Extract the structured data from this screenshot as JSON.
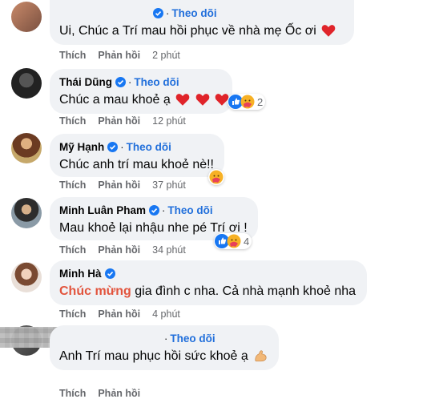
{
  "comments": [
    {
      "name": "",
      "follow": "Theo dõi",
      "text": "Ui, Chúc a Trí mau hồi phục về nhà mẹ Ốc ơi",
      "like": "Thích",
      "reply": "Phản hồi",
      "time": "2 phút",
      "trailing_emoji": "red-heart"
    },
    {
      "name": "Thái Dũng",
      "follow": "Theo dõi",
      "text": "Chúc a mau khoẻ ạ",
      "like": "Thích",
      "reply": "Phản hồi",
      "time": "12 phút",
      "trailing_emoji": "red-heart x3",
      "reaction_count": "2"
    },
    {
      "name": "Mỹ Hạnh",
      "follow": "Theo dõi",
      "text": "Chúc anh trí mau khoẻ nè!!",
      "like": "Thích",
      "reply": "Phản hồi",
      "time": "37 phút"
    },
    {
      "name": "Minh Luân Pham",
      "follow": "Theo dõi",
      "text": "Mau khoẻ lại nhậu nhe pé Trí ơi !",
      "like": "Thích",
      "reply": "Phản hồi",
      "time": "34 phút",
      "reaction_count": "4"
    },
    {
      "name": "Minh Hà",
      "follow": "",
      "text_highlight": "Chúc mừng",
      "text": " gia đình c nha. Cả nhà mạnh khoẻ nha",
      "like": "Thích",
      "reply": "Phản hồi",
      "time": "4 phút"
    },
    {
      "name": "",
      "follow": "Theo dõi",
      "text": "Anh Trí mau phục hồi sức khoẻ ạ",
      "like": "Thích",
      "reply": "Phản hồi",
      "time": "",
      "trailing_emoji": "flexed-biceps"
    }
  ],
  "colors": {
    "bubble": "#f0f2f5",
    "follow": "#216fdb",
    "meta": "#65676b",
    "highlight": "#e2543d",
    "verified": "#1877f2"
  }
}
